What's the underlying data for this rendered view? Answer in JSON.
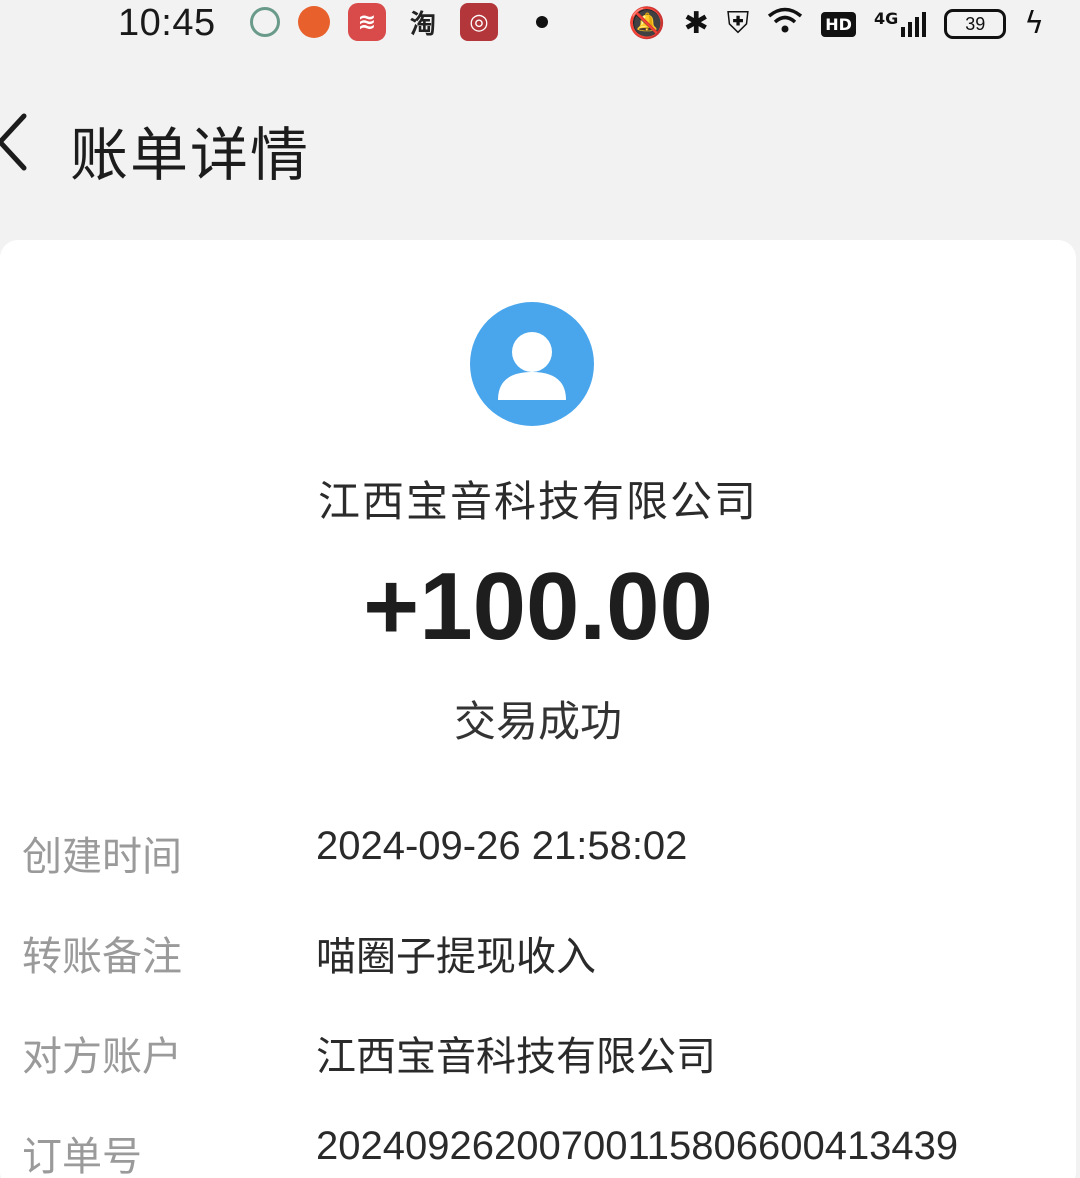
{
  "status_bar": {
    "time": "10:45",
    "notification_icons": [
      "eye-app-icon",
      "basketball-app-icon",
      "red-app-icon",
      "taobao-icon",
      "bank-app-icon"
    ],
    "taobao_char": "淘",
    "hd_label": "HD",
    "network_label": "4G",
    "battery_level": "39"
  },
  "header": {
    "title": "账单详情"
  },
  "bill": {
    "payer_name": "江西宝音科技有限公司",
    "amount": "+100.00",
    "status": "交易成功"
  },
  "details": [
    {
      "label": "创建时间",
      "value": "2024-09-26 21:58:02"
    },
    {
      "label": "转账备注",
      "value": "喵圈子提现收入"
    },
    {
      "label": "对方账户",
      "value": "江西宝音科技有限公司"
    },
    {
      "label": "订单号",
      "value": "20240926200700115806600413439"
    }
  ],
  "colors": {
    "avatar_bg": "#4aa6ec",
    "page_bg": "#f2f2f2",
    "card_bg": "#ffffff",
    "label_gray": "#9a9a9a"
  }
}
